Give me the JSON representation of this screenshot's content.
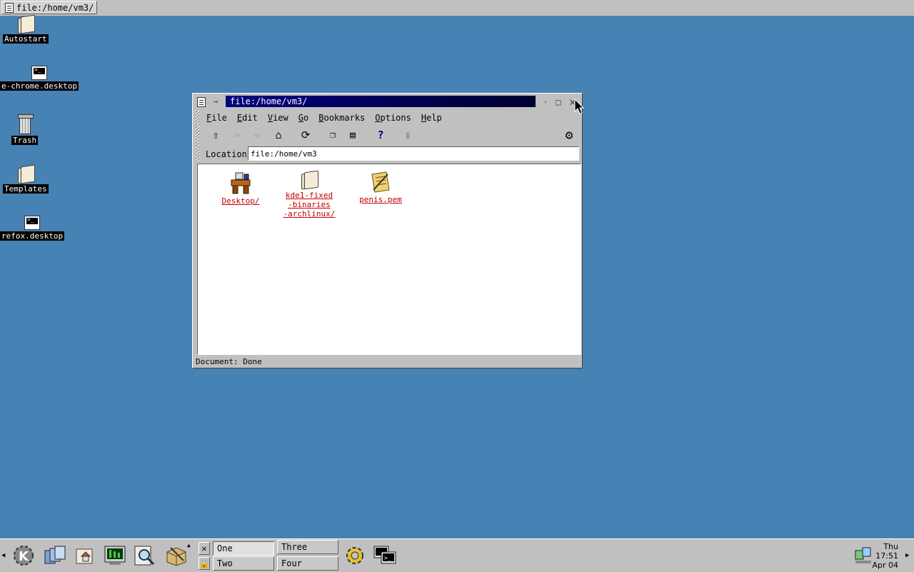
{
  "topbar": {
    "task_label": "file:/home/vm3/"
  },
  "desktop_icons": [
    {
      "label": "Autostart",
      "icon": "folder-icon"
    },
    {
      "label": "e-chrome.desktop",
      "icon": "terminal-icon"
    },
    {
      "label": "Trash",
      "icon": "trash-icon"
    },
    {
      "label": "Templates",
      "icon": "folder-icon"
    },
    {
      "label": "refox.desktop",
      "icon": "terminal-icon"
    }
  ],
  "window": {
    "title": "file:/home/vm3/",
    "menu": [
      "File",
      "Edit",
      "View",
      "Go",
      "Bookmarks",
      "Options",
      "Help"
    ],
    "menu_underline": [
      "F",
      "E",
      "V",
      "G",
      "B",
      "O",
      "H"
    ],
    "location_label": "Location:",
    "location_value": "file:/home/vm3",
    "files": [
      {
        "name": "Desktop/",
        "icon": "desk-icon"
      },
      {
        "name": "kde1-fixed\n-binaries\n-archlinux/",
        "icon": "folder-icon"
      },
      {
        "name": "penis.pem",
        "icon": "document-icon"
      }
    ],
    "status": "Document: Done"
  },
  "panel": {
    "desktops": [
      "One",
      "Two",
      "Three",
      "Four"
    ],
    "active_desktop": "One",
    "clock": {
      "day": "Thu",
      "time": "17:51",
      "date": "Apr 04"
    }
  }
}
